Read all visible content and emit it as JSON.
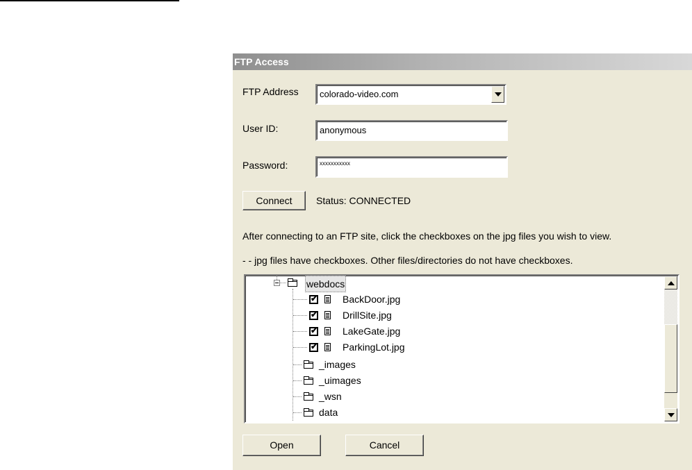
{
  "dialog": {
    "title": "FTP Access",
    "ftp_address": {
      "label": "FTP Address",
      "value": "colorado-video.com"
    },
    "user_id": {
      "label": "User ID:",
      "value": "anonymous"
    },
    "password": {
      "label": "Password:",
      "value": "xxxxxxxxxxx"
    },
    "connect_label": "Connect",
    "status_text": "Status:  CONNECTED",
    "instruction_1": "After connecting to an FTP site, click the checkboxes on the jpg files you wish to view.",
    "instruction_2": "- - jpg files have checkboxes.  Other files/directories do not have checkboxes.",
    "tree": {
      "root": "webdocs",
      "files": [
        {
          "name": "BackDoor.jpg",
          "checked": true
        },
        {
          "name": "DrillSite.jpg",
          "checked": true
        },
        {
          "name": "LakeGate.jpg",
          "checked": true
        },
        {
          "name": "ParkingLot.jpg",
          "checked": true
        }
      ],
      "folders": [
        "_images",
        "_uimages",
        "_wsn",
        "data"
      ],
      "check_glyph": "✔"
    },
    "open_label": "Open",
    "cancel_label": "Cancel"
  }
}
